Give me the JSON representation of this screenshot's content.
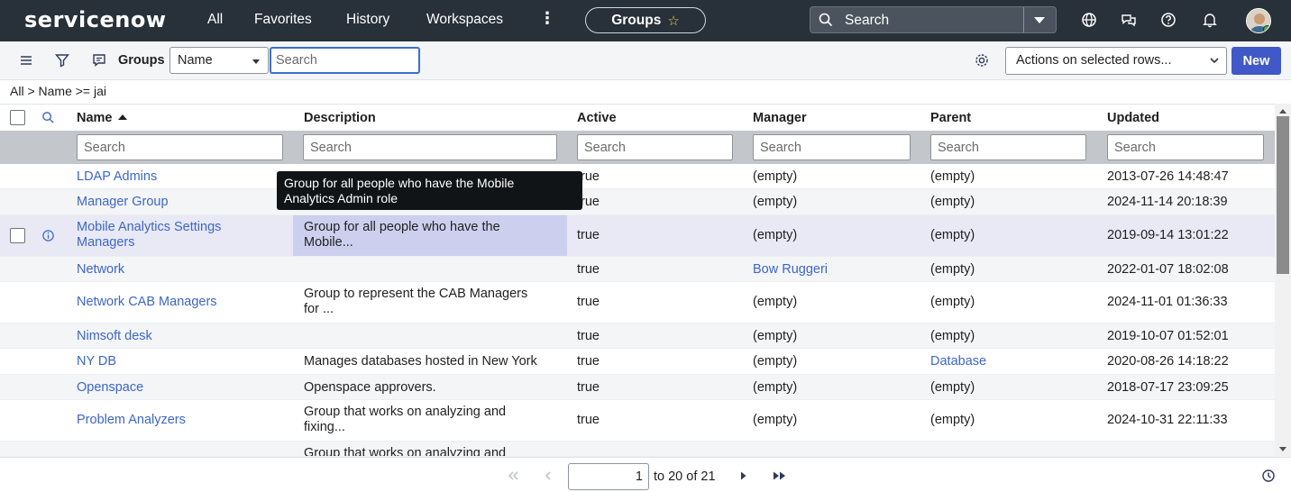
{
  "nav": {
    "logo": "servicenow",
    "items": [
      "All",
      "Favorites",
      "History",
      "Workspaces"
    ],
    "context_pill": "Groups",
    "search_placeholder": "Search"
  },
  "toolbar": {
    "list_title": "Groups",
    "field_select": "Name",
    "search_placeholder": "Search",
    "actions_label": "Actions on selected rows...",
    "new_label": "New"
  },
  "breadcrumb": "All > Name >= jai",
  "columns": [
    "Name",
    "Description",
    "Active",
    "Manager",
    "Parent",
    "Updated"
  ],
  "filter_placeholder": "Search",
  "rows": [
    {
      "name": "LDAP Admins",
      "desc1": "",
      "desc2": "",
      "active": "true",
      "manager": "(empty)",
      "parent": "(empty)",
      "updated": "2013-07-26 14:48:47"
    },
    {
      "name": "Manager Group",
      "desc1": "",
      "desc2": "",
      "active": "true",
      "manager": "(empty)",
      "parent": "(empty)",
      "updated": "2024-11-14 20:18:39"
    },
    {
      "name1": "Mobile Analytics Settings",
      "name2": "Managers",
      "desc1": "Group for all people who have the",
      "desc2": "Mobile...",
      "active": "true",
      "manager": "(empty)",
      "parent": "(empty)",
      "updated": "2019-09-14 13:01:22"
    },
    {
      "name": "Network",
      "desc1": "",
      "desc2": "",
      "active": "true",
      "manager": "Bow Ruggeri",
      "parent": "(empty)",
      "updated": "2022-01-07 18:02:08"
    },
    {
      "name": "Network CAB Managers",
      "desc1": "Group to represent the CAB Managers",
      "desc2": "for ...",
      "active": "true",
      "manager": "(empty)",
      "parent": "(empty)",
      "updated": "2024-11-01 01:36:33"
    },
    {
      "name": "Nimsoft desk",
      "desc1": "",
      "desc2": "",
      "active": "true",
      "manager": "(empty)",
      "parent": "(empty)",
      "updated": "2019-10-07 01:52:01"
    },
    {
      "name": "NY DB",
      "desc1": "Manages databases hosted in New York",
      "desc2": "",
      "active": "true",
      "manager": "(empty)",
      "parent": "Database",
      "updated": "2020-08-26 14:18:22"
    },
    {
      "name": "Openspace",
      "desc1": "Openspace approvers.",
      "desc2": "",
      "active": "true",
      "manager": "(empty)",
      "parent": "(empty)",
      "updated": "2018-07-17 23:09:25"
    },
    {
      "name": "Problem Analyzers",
      "desc1": "Group that works on analyzing and",
      "desc2": "fixing...",
      "active": "true",
      "manager": "(empty)",
      "parent": "(empty)",
      "updated": "2024-10-31 22:11:33"
    },
    {
      "name": "",
      "desc1": "Group that works on analyzing and",
      "desc2": "",
      "active": "",
      "manager": "",
      "parent": "",
      "updated": ""
    }
  ],
  "tooltip": {
    "line1": "Group for all people who have the Mobile",
    "line2": "Analytics Admin role"
  },
  "pagination": {
    "page_value": "1",
    "range_text": "to 20 of 21"
  },
  "colors": {
    "nav_bg": "#283039",
    "link": "#3d66c8",
    "accent": "#4158c8",
    "highlight_row": "#e8e9f5"
  }
}
